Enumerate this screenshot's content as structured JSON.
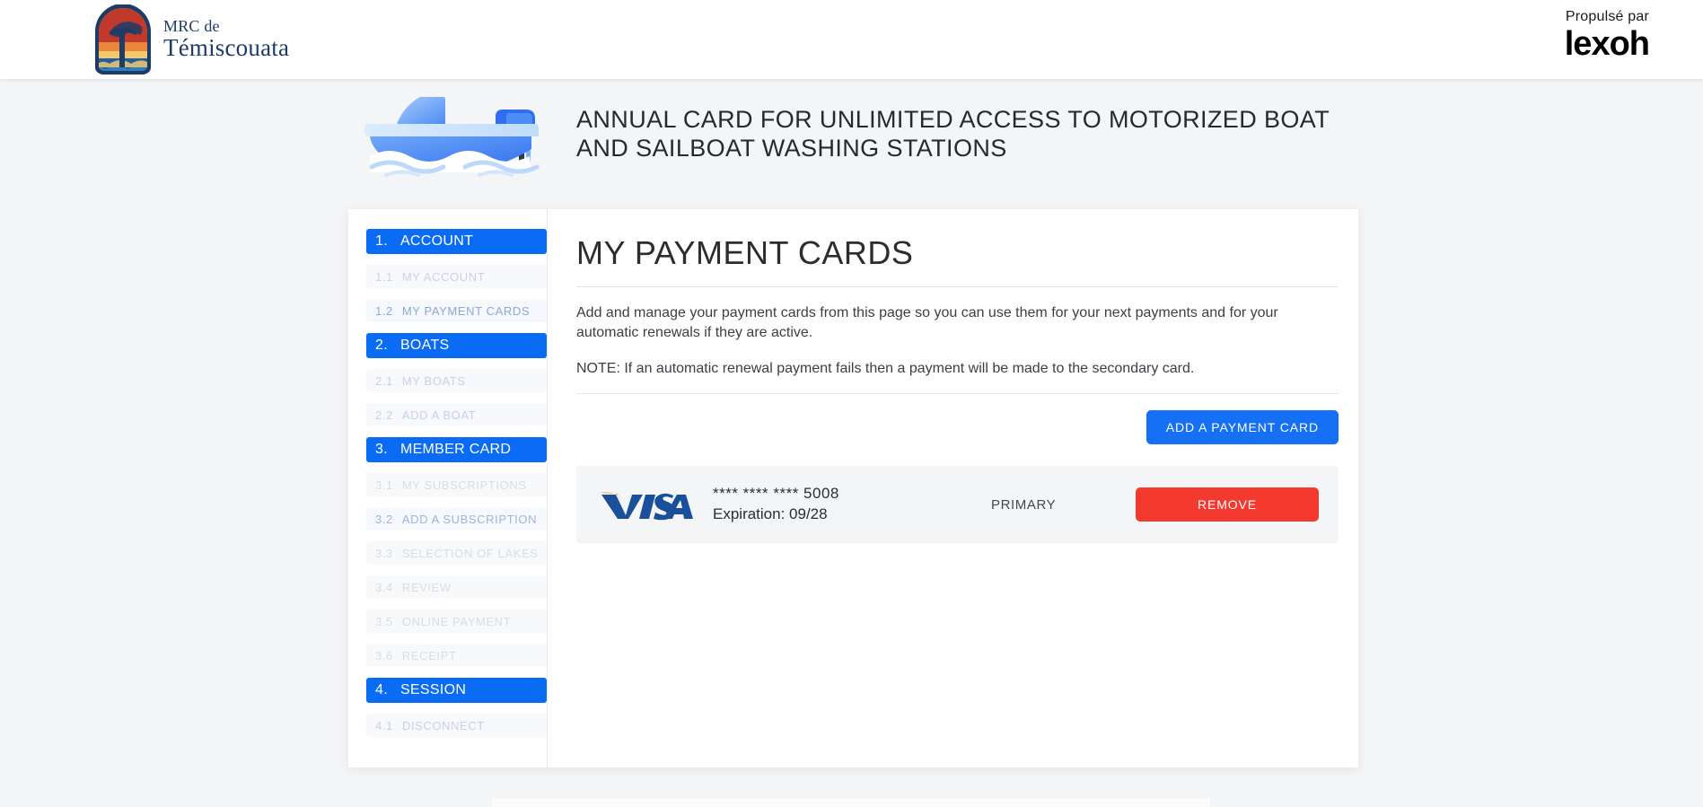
{
  "header": {
    "logo_icon": "mrc-temiscouata-crest-icon",
    "brand_line1": "MRC de",
    "brand_line2": "Témiscouata",
    "powered_label": "Propulsé par",
    "powered_brand": "lexoh"
  },
  "banner": {
    "illustration_icon": "motorboat-illustration-icon",
    "title": "ANNUAL CARD FOR UNLIMITED ACCESS TO MOTORIZED BOAT AND SAILBOAT WASHING STATIONS"
  },
  "sidebar": {
    "items": [
      {
        "num": "1.",
        "label": "ACCOUNT",
        "type": "section"
      },
      {
        "num": "1.1",
        "label": "MY ACCOUNT",
        "type": "sub"
      },
      {
        "num": "1.2",
        "label": "MY PAYMENT CARDS",
        "type": "active"
      },
      {
        "num": "2.",
        "label": "BOATS",
        "type": "section"
      },
      {
        "num": "2.1",
        "label": "MY BOATS",
        "type": "sub"
      },
      {
        "num": "2.2",
        "label": "ADD A BOAT",
        "type": "sub"
      },
      {
        "num": "3.",
        "label": "MEMBER CARD",
        "type": "section"
      },
      {
        "num": "3.1",
        "label": "MY SUBSCRIPTIONS",
        "type": "muted"
      },
      {
        "num": "3.2",
        "label": "ADD A SUBSCRIPTION",
        "type": "enabled"
      },
      {
        "num": "3.3",
        "label": "SELECTION OF LAKES",
        "type": "muted"
      },
      {
        "num": "3.4",
        "label": "REVIEW",
        "type": "muted"
      },
      {
        "num": "3.5",
        "label": "ONLINE PAYMENT",
        "type": "muted"
      },
      {
        "num": "3.6",
        "label": "RECEIPT",
        "type": "muted"
      },
      {
        "num": "4.",
        "label": "SESSION",
        "type": "section"
      },
      {
        "num": "4.1",
        "label": "DISCONNECT",
        "type": "sub"
      }
    ]
  },
  "main": {
    "title": "MY PAYMENT CARDS",
    "intro": "Add and manage your payment cards from this page so you can use them for your next payments and for your automatic renewals if they are active.",
    "note": "NOTE: If an automatic renewal payment fails then a payment will be made to the secondary card.",
    "add_card_button": "ADD A PAYMENT CARD",
    "cards": [
      {
        "brand_icon": "visa-logo-icon",
        "brand": "VISA",
        "number": "**** **** **** 5008",
        "expiration": "Expiration: 09/28",
        "status": "PRIMARY",
        "remove_button": "REMOVE"
      }
    ]
  },
  "colors": {
    "accent_blue": "#0a6cf5",
    "button_blue": "#1570f5",
    "danger_red": "#f43a2f",
    "page_bg": "#f4f5f6",
    "panel_bg": "#ffffff",
    "brand_navy": "#1d3c66",
    "visa_blue": "#1a4f9c",
    "visa_gold": "#f0a72b"
  }
}
